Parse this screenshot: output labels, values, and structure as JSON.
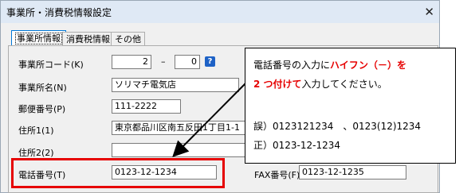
{
  "window": {
    "title": "事業所・消費税情報設定",
    "close_glyph": "✕"
  },
  "tabs": [
    {
      "label": "事業所情報"
    },
    {
      "label": "消費税情報"
    },
    {
      "label": "その他"
    }
  ],
  "form": {
    "office_code": {
      "label": "事業所コード(K)",
      "value1": "2",
      "separator": "–",
      "value2": "0",
      "help": "?"
    },
    "office_name": {
      "label": "事業所名(N)",
      "value": "ソリマチ電気店"
    },
    "postal": {
      "label": "郵便番号(P)",
      "value": "111-2222"
    },
    "address1": {
      "label": "住所1(1)",
      "value": "東京都品川区南五反田1丁目1-1"
    },
    "address2": {
      "label": "住所2(2)",
      "value": ""
    },
    "phone": {
      "label": "電話番号(T)",
      "value": "0123-12-1234"
    },
    "fax": {
      "label": "FAX番号(F)",
      "value": "0123-12-1235"
    }
  },
  "callout": {
    "line1_prefix": "電話番号の入力に",
    "line1_red": "ハイフン（－）を",
    "line2_red": "2 つ付けて",
    "line2_suffix": "入力してください。",
    "wrong": "誤）0123121234　、0123(12)1234",
    "right": "正）0123-12-1234"
  },
  "colors": {
    "highlight": "#e60000",
    "accent": "#1e62c6"
  }
}
